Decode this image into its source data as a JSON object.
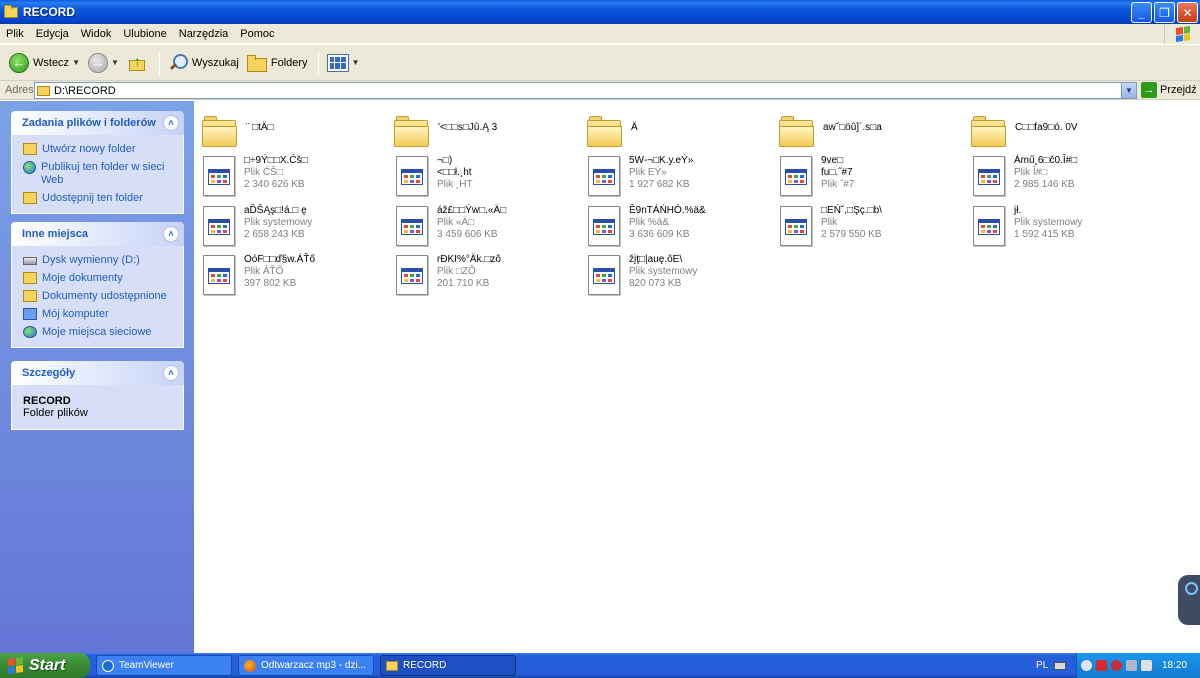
{
  "window": {
    "title": "RECORD",
    "min": "_",
    "max": "❐",
    "close": "✕"
  },
  "menu": [
    "Plik",
    "Edycja",
    "Widok",
    "Ulubione",
    "Narzędzia",
    "Pomoc"
  ],
  "toolbar": {
    "back_label": "Wstecz",
    "search_label": "Wyszukaj",
    "folders_label": "Foldery"
  },
  "address": {
    "label": "Adres",
    "value": "D:\\RECORD",
    "go_label": "Przejdź"
  },
  "tasks_panel": {
    "title": "Zadania plików i folderów",
    "links": [
      "Utwórz nowy folder",
      "Publikuj ten folder w sieci Web",
      "Udostępnij ten folder"
    ]
  },
  "places_panel": {
    "title": "Inne miejsca",
    "links": [
      "Dysk wymienny (D:)",
      "Moje dokumenty",
      "Dokumenty udostępnione",
      "Mój komputer",
      "Moje miejsca sieciowe"
    ]
  },
  "details_panel": {
    "title": "Szczegóły",
    "name": "RECORD",
    "type": "Folder plików"
  },
  "folders": [
    {
      "name": "¨ □tÄ□"
    },
    {
      "name": "'<□□s□Jû.Ą 3"
    },
    {
      "name": "Ä"
    },
    {
      "name": "aw˘□öû]´.s□a"
    },
    {
      "name": "C□□fa9□ó. 0V"
    }
  ],
  "files": [
    {
      "name": "□÷9Ý□□X.Ćš□",
      "type": "Plik ĆŠ□",
      "size": "2 340 626 KB"
    },
    {
      "name": "¬□)",
      "name2": "<□□ł.¸ht",
      "type": "Plik ¸HT",
      "size": ""
    },
    {
      "name": "5W-¬□K.y.eÝ»",
      "type": "Plik EÝ»",
      "size": "1 927 682 KB"
    },
    {
      "name": "9ve□",
      "name2": "fu□.˝#7",
      "type": "Plik ˝#7",
      "size": ""
    },
    {
      "name": "Ámű¸6□č0.Î#□",
      "type": "Plik Î#□",
      "size": "2 985 146 KB"
    },
    {
      "name": "aĎŠĄş□!á.□ ę",
      "type": "Plik systemowy",
      "size": "2 658 243 KB"
    },
    {
      "name": "áž£□□Ýw□.«Ä□",
      "type": "Plik «Ä□",
      "size": "3 459 606 KB"
    },
    {
      "name": "Ě9nTÁŃHÓ.%ä&",
      "type": "Plik %ä&",
      "size": "3 636 609 KB"
    },
    {
      "name": "□EŃ˘,□Şç.□b\\",
      "type": "Plik",
      "size": "2 579 550 KB"
    },
    {
      "name": "jł.",
      "type": "Plik systemowy",
      "size": "1 592 415 KB"
    },
    {
      "name": "OóF□□ď§w.ÁŤő",
      "type": "Plik ÁŤŐ",
      "size": "397 802 KB"
    },
    {
      "name": "rĐKI%°Äk.□zô",
      "type": "Plik □ZÔ",
      "size": "201 710 KB"
    },
    {
      "name": "žįţ□|auę.ôE\\",
      "type": "Plik systemowy",
      "size": "820 073 KB"
    }
  ],
  "taskbar": {
    "start_label": "Start",
    "tasks": [
      "TeamViewer",
      "Odtwarzacz mp3 - dzi...",
      "RECORD"
    ],
    "lang": "PL",
    "time": "18:20"
  }
}
